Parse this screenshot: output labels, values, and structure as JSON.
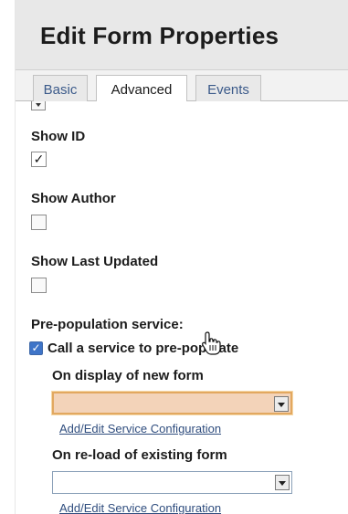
{
  "panel": {
    "title": "Edit Form Properties"
  },
  "tabs": [
    {
      "label": "Basic",
      "active": false
    },
    {
      "label": "Advanced",
      "active": true
    },
    {
      "label": "Events",
      "active": false
    }
  ],
  "fields": {
    "show_id": {
      "label": "Show ID",
      "checked": true,
      "check_glyph": "✓"
    },
    "show_author": {
      "label": "Show Author",
      "checked": false
    },
    "show_last_updated": {
      "label": "Show Last Updated",
      "checked": false
    }
  },
  "prepopulation": {
    "section_label": "Pre-population service:",
    "call_service": {
      "label": "Call a service to pre-populate",
      "checked": true,
      "check_glyph": "✓"
    },
    "new_form": {
      "label": "On display of new form",
      "selected_value": "",
      "link": "Add/Edit Service Configuration"
    },
    "reload_form": {
      "label": "On re-load of existing form",
      "selected_value": "",
      "link": "Add/Edit Service Configuration"
    }
  },
  "colors": {
    "header_bg": "#e8e8e8",
    "tab_text": "#3b5a8a",
    "link": "#2f4d7e",
    "active_select_bg": "#f3d3b9",
    "active_select_border": "#e2a860",
    "checkbox_accent": "#3e74c8"
  }
}
